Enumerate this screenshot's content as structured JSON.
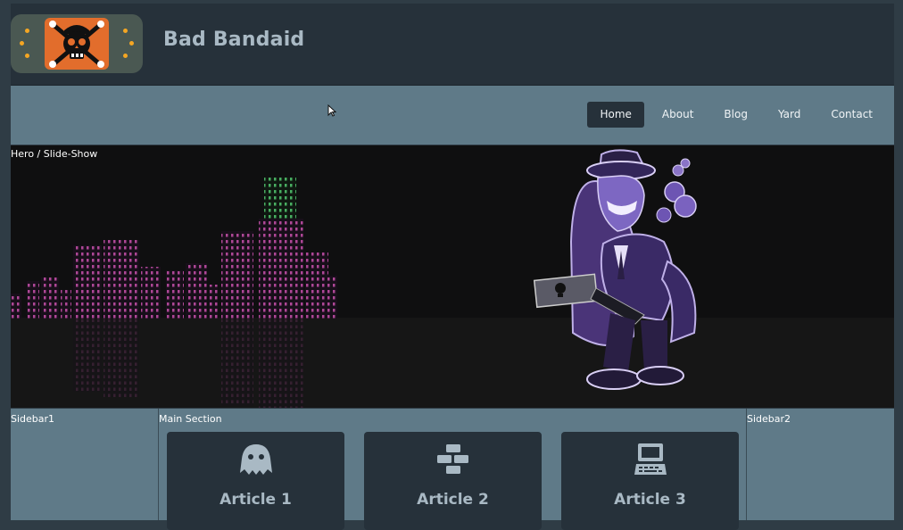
{
  "header": {
    "site_title": "Bad Bandaid",
    "logo_icon": "skull-crossbones-bandaid-icon"
  },
  "nav": {
    "items": [
      {
        "label": "Home",
        "active": true
      },
      {
        "label": "About",
        "active": false
      },
      {
        "label": "Blog",
        "active": false
      },
      {
        "label": "Yard",
        "active": false
      },
      {
        "label": "Contact",
        "active": false
      }
    ]
  },
  "hero": {
    "label": "Hero / Slide-Show"
  },
  "layout": {
    "sidebar1_label": "Sidebar1",
    "main_label": "Main Section",
    "sidebar2_label": "Sidebar2"
  },
  "articles": [
    {
      "title": "Article 1",
      "icon": "ghost-icon"
    },
    {
      "title": "Article 2",
      "icon": "bricks-icon"
    },
    {
      "title": "Article 3",
      "icon": "computer-icon"
    }
  ],
  "colors": {
    "header_bg": "#26313a",
    "nav_bg": "#5f7a88",
    "accent_orange": "#e26d2c",
    "title_text": "#a9b9c4",
    "hero_bg": "#0f0f10"
  }
}
